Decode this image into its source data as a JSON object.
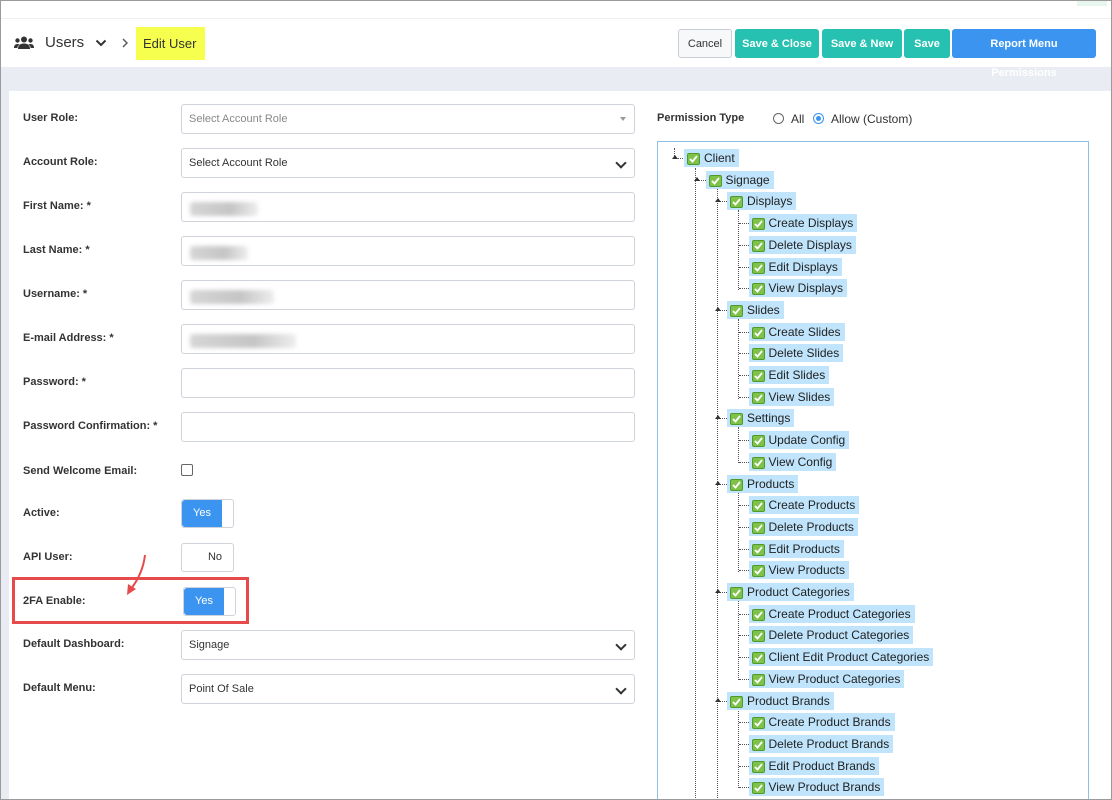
{
  "header": {
    "module": "Users",
    "current_page": "Edit User",
    "buttons": {
      "cancel": "Cancel",
      "save_close": "Save & Close",
      "save_new": "Save & New",
      "save": "Save",
      "report_menu": "Report Menu Permissions"
    }
  },
  "form": {
    "user_role": {
      "label": "User Role:",
      "placeholder": "Select Account Role"
    },
    "account_role": {
      "label": "Account Role:",
      "value": "Select Account Role"
    },
    "first_name": {
      "label": "First Name: *"
    },
    "last_name": {
      "label": "Last Name: *"
    },
    "username": {
      "label": "Username: *"
    },
    "email": {
      "label": "E-mail Address: *"
    },
    "password": {
      "label": "Password: *"
    },
    "password_confirm": {
      "label": "Password Confirmation: *"
    },
    "send_welcome": {
      "label": "Send Welcome Email:"
    },
    "active": {
      "label": "Active:",
      "value": "Yes"
    },
    "api_user": {
      "label": "API User:",
      "value": "No"
    },
    "twofa": {
      "label": "2FA Enable:",
      "value": "Yes"
    },
    "default_dashboard": {
      "label": "Default Dashboard:",
      "value": "Signage"
    },
    "default_menu": {
      "label": "Default Menu:",
      "value": "Point Of Sale"
    }
  },
  "permissions": {
    "label": "Permission Type",
    "options": [
      "All",
      "Allow (Custom)"
    ],
    "selected": "Allow (Custom)",
    "tree": {
      "root": "Client",
      "signage": "Signage",
      "displays": {
        "name": "Displays",
        "children": [
          "Create Displays",
          "Delete Displays",
          "Edit Displays",
          "View Displays"
        ]
      },
      "slides": {
        "name": "Slides",
        "children": [
          "Create Slides",
          "Delete Slides",
          "Edit Slides",
          "View Slides"
        ]
      },
      "settings": {
        "name": "Settings",
        "children": [
          "Update Config",
          "View Config"
        ]
      },
      "products": {
        "name": "Products",
        "children": [
          "Create Products",
          "Delete Products",
          "Edit Products",
          "View Products"
        ]
      },
      "product_categories": {
        "name": "Product Categories",
        "children": [
          "Create Product Categories",
          "Delete Product Categories",
          "Client Edit Product Categories",
          "View Product Categories"
        ]
      },
      "product_brands": {
        "name": "Product Brands",
        "children": [
          "Create Product Brands",
          "Delete Product Brands",
          "Edit Product Brands",
          "View Product Brands"
        ]
      }
    }
  },
  "colors": {
    "teal": "#26c1b0",
    "blue": "#3b94ef",
    "highlight": "#f6ff4e",
    "annotation_red": "#e64a4a",
    "tree_node": "#bfe4fb"
  }
}
